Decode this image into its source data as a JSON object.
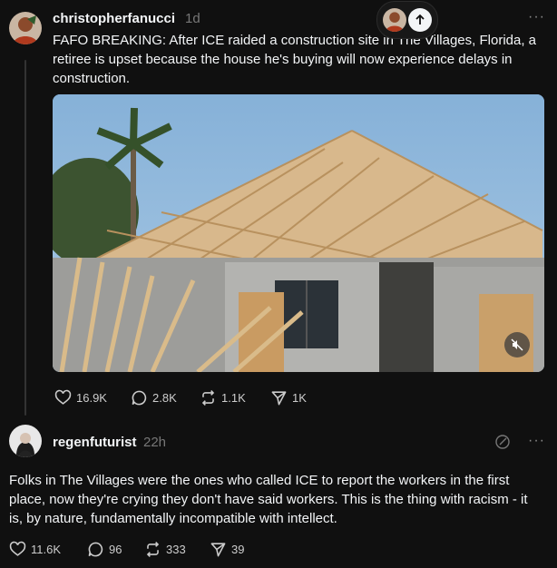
{
  "post1": {
    "username": "christopherfanucci",
    "time": "1d",
    "text": "FAFO BREAKING: After ICE raided a construction site in The Villages, Florida, a retiree is upset because the house he's buying will now experience delays in construction.",
    "stats": {
      "likes": "16.9K",
      "replies": "2.8K",
      "reposts": "1.1K",
      "shares": "1K"
    }
  },
  "post2": {
    "username": "regenfuturist",
    "time": "22h",
    "text": "Folks in The Villages were the ones who called ICE to report the workers in the first place, now they're crying they don't have said workers. This is the thing with racism - it is, by nature, fundamentally incompatible with intellect.",
    "stats": {
      "likes": "11.6K",
      "replies": "96",
      "reposts": "333",
      "shares": "39"
    }
  },
  "icons": {
    "more": "more-horizontal-icon",
    "like": "heart-icon",
    "reply": "comment-icon",
    "repost": "repost-icon",
    "share": "send-icon",
    "mute": "volume-muted-icon",
    "scroll_up": "arrow-up-icon"
  },
  "colors": {
    "background": "#101010",
    "text": "#f3f5f7",
    "muted": "#777777"
  }
}
